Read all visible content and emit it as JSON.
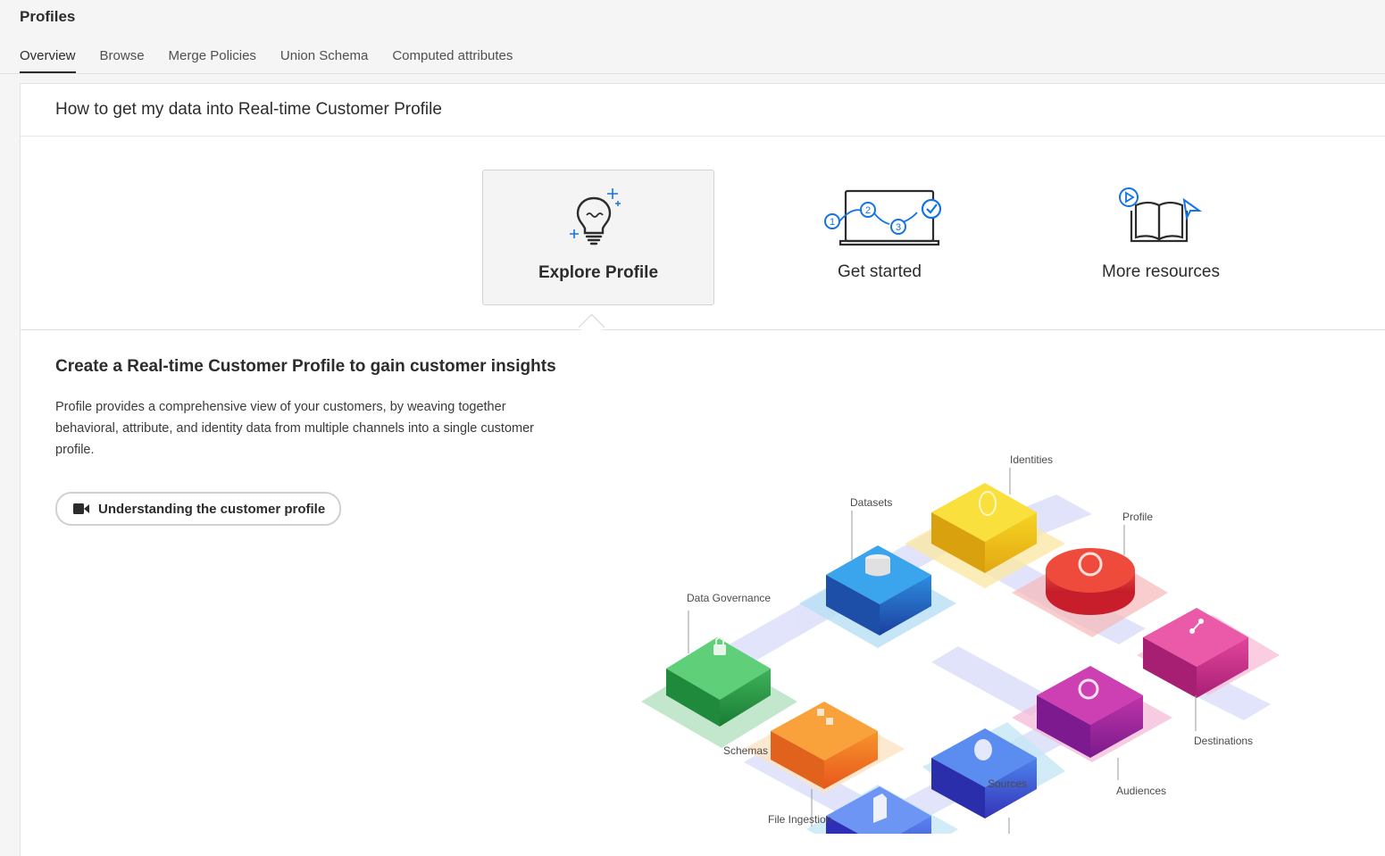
{
  "app": {
    "title": "Profiles"
  },
  "tabs": [
    {
      "label": "Overview",
      "active": true
    },
    {
      "label": "Browse",
      "active": false
    },
    {
      "label": "Merge Policies",
      "active": false
    },
    {
      "label": "Union Schema",
      "active": false
    },
    {
      "label": "Computed attributes",
      "active": false
    }
  ],
  "card": {
    "header": "How to get my data into Real-time Customer Profile",
    "tiles": [
      {
        "label": "Explore Profile",
        "icon": "lightbulb-icon",
        "selected": true
      },
      {
        "label": "Get started",
        "icon": "laptop-steps-icon",
        "selected": false
      },
      {
        "label": "More resources",
        "icon": "book-resources-icon",
        "selected": false
      }
    ]
  },
  "section": {
    "title": "Create a Real-time Customer Profile to gain customer insights",
    "body": "Profile provides a comprehensive view of your customers, by weaving together behavioral, attribute, and identity data from multiple channels into a single customer profile.",
    "video_button": {
      "label": "Understanding the customer profile",
      "icon": "video-camera-icon"
    }
  },
  "diagram": {
    "labels": {
      "identities": "Identities",
      "datasets": "Datasets",
      "profile": "Profile",
      "data_governance": "Data Governance",
      "destinations": "Destinations",
      "audiences": "Audiences",
      "schemas": "Schemas",
      "sources": "Sources",
      "file_ingestion": "File Ingestion"
    },
    "steps": {
      "one": "1",
      "two": "2",
      "three": "3"
    }
  },
  "colors": {
    "accent_blue": "#1473e6",
    "governance_green": "#2a9d4a",
    "datasets_blue": "#2062c7",
    "identities_yellow": "#f2c314",
    "profile_red": "#e0302a",
    "destinations_magenta": "#d6338a",
    "audiences_purple": "#a0249b",
    "schemas_orange": "#f07a22",
    "sources_blue": "#3d5fe0",
    "file_ingestion_blue": "#4a5de8"
  }
}
